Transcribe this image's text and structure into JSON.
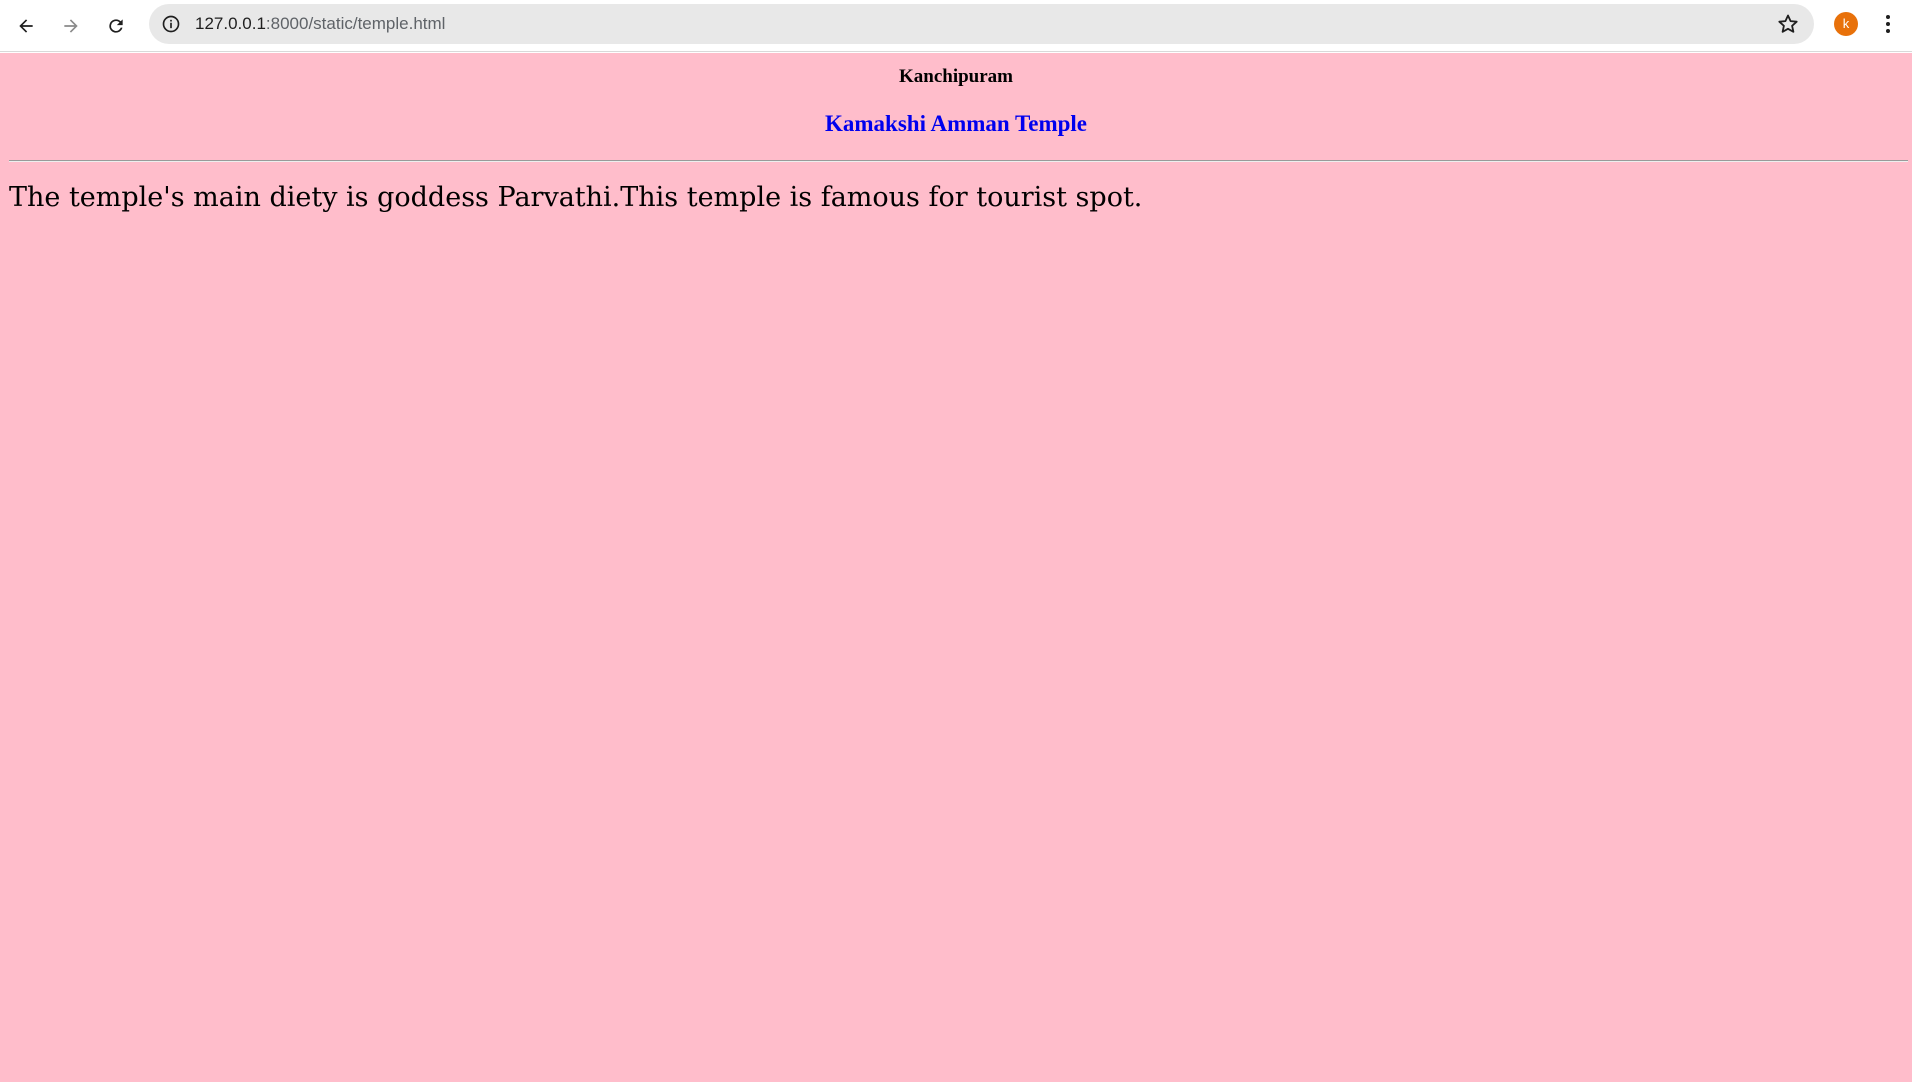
{
  "browser": {
    "url_host": "127.0.0.1",
    "url_path": ":8000/static/temple.html",
    "profile_initial": "k",
    "profile_color": "#e8710a",
    "icons": [
      "back-arrow-icon",
      "forward-arrow-icon",
      "reload-icon",
      "info-icon",
      "star-icon",
      "kebab-menu-icon"
    ]
  },
  "page": {
    "background_color": "#ffbdcb",
    "heading": "Kanchipuram",
    "link_text": "Kamakshi Amman Temple",
    "link_color": "#0000ee",
    "paragraph": "The temple's main diety is goddess Parvathi.This temple is famous for tourist spot."
  }
}
